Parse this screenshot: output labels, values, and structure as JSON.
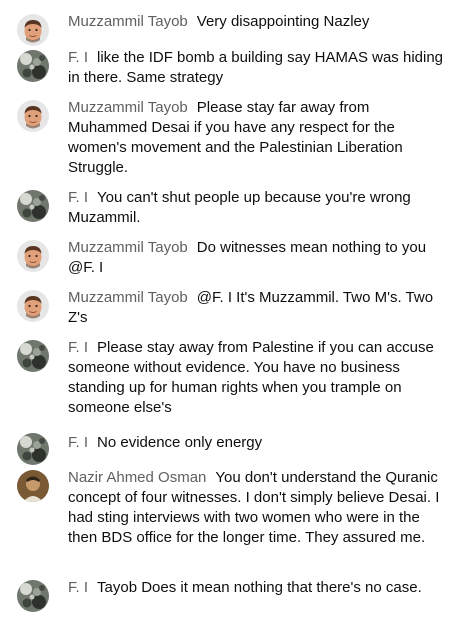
{
  "comments": [
    {
      "author": "Muzzammil Tayob",
      "message": "Very disappointing Nazley",
      "avatar": "memoji-avatar"
    },
    {
      "author": "F. I",
      "message": "like the IDF bomb a building say HAMAS was hiding in there. Same strategy",
      "avatar": "cat-photo-avatar"
    },
    {
      "author": "Muzzammil Tayob",
      "message": "Please stay far away from Muhammed Desai if you have any respect for the women's movement and the Palestinian Liberation Struggle.",
      "avatar": "memoji-avatar"
    },
    {
      "author": "F. I",
      "message": "You can't shut people up because you're wrong Muzammil.",
      "avatar": "cat-photo-avatar"
    },
    {
      "author": "Muzzammil Tayob",
      "message": "Do witnesses mean nothing to you @F. I",
      "avatar": "memoji-avatar"
    },
    {
      "author": "Muzzammil Tayob",
      "message": "@F. I It's Muzzammil. Two M's. Two Z's",
      "avatar": "memoji-avatar"
    },
    {
      "author": "F. I",
      "message": "Please stay away from Palestine if you can accuse someone without evidence. You have no business standing up for human rights when you trample on someone else's",
      "avatar": "cat-photo-avatar"
    },
    {
      "author": "F. I",
      "message": "No evidence only energy",
      "avatar": "cat-photo-avatar"
    },
    {
      "author": "Nazir Ahmed Osman",
      "message": "You don't understand the Quranic concept of four witnesses. I don't simply believe Desai. I had sting interviews with two women who were in the then BDS office for the longer time. They assured me.",
      "avatar": "person-photo-avatar"
    },
    {
      "author": "F. I",
      "message": "Tayob Does it mean nothing that there's no case.",
      "avatar": "cat-photo-avatar"
    }
  ]
}
